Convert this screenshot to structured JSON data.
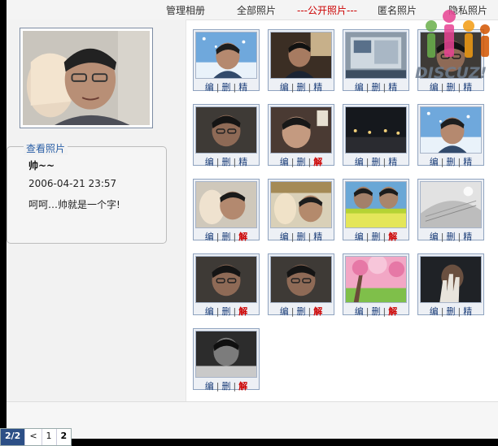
{
  "nav": {
    "items": [
      "管理相册",
      "全部照片",
      "---公开照片---",
      "匿名照片",
      "隐私照片"
    ],
    "active_index": 2
  },
  "sidebar": {
    "legend": "查看照片",
    "photo_name": "帅~~",
    "photo_date": "2006-04-21 23:57",
    "photo_desc": "呵呵…帅就是一个字!"
  },
  "actions": {
    "edit": "编",
    "delete": "删",
    "feature": "精",
    "unfeature": "解"
  },
  "thumbnails": [
    {
      "scene": "winter-person",
      "featured": false
    },
    {
      "scene": "dark-room-person",
      "featured": false
    },
    {
      "scene": "desktop-gray",
      "featured": false
    },
    {
      "scene": "dark-face",
      "featured": false
    },
    {
      "scene": "dark-face",
      "featured": false
    },
    {
      "scene": "dark-face-light",
      "featured": true
    },
    {
      "scene": "night-street",
      "featured": false
    },
    {
      "scene": "winter-person",
      "featured": false
    },
    {
      "scene": "light-face",
      "featured": true
    },
    {
      "scene": "collage-face",
      "featured": false
    },
    {
      "scene": "field-couple",
      "featured": true
    },
    {
      "scene": "gray-sketch",
      "featured": false
    },
    {
      "scene": "dark-face",
      "featured": true
    },
    {
      "scene": "dark-face",
      "featured": true
    },
    {
      "scene": "blossom-pink",
      "featured": true
    },
    {
      "scene": "hand-dark",
      "featured": false
    },
    {
      "scene": "dark-gray-face",
      "featured": true
    }
  ],
  "watermark": {
    "text": "DISCUZ!"
  },
  "pager": {
    "total": "2/2",
    "prev": "<",
    "pages": [
      "1",
      "2"
    ],
    "current": "2"
  },
  "colors": {
    "link": "#1d3f7a",
    "active": "#cc0000",
    "pager_bg": "#2c4f86"
  }
}
